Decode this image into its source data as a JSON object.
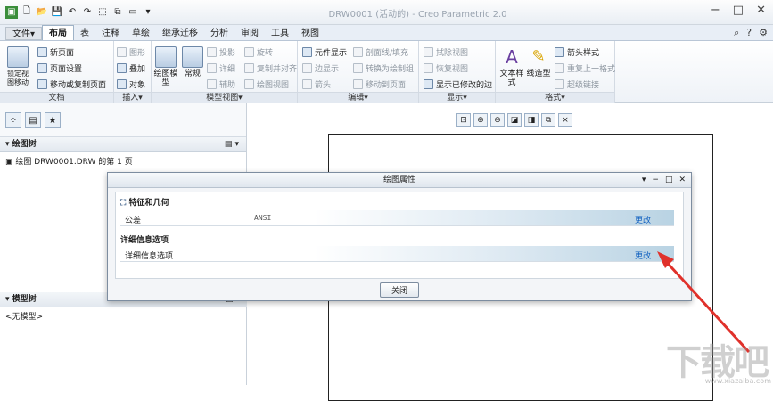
{
  "window": {
    "title": "DRW0001 (活动的) - Creo Parametric 2.0"
  },
  "tabs": [
    "文件▾",
    "布局",
    "表",
    "注释",
    "草绘",
    "继承迁移",
    "分析",
    "审阅",
    "工具",
    "视图"
  ],
  "ribbon": {
    "doc": {
      "label": "文档",
      "big": "锁定视图移动",
      "items": [
        "新页面",
        "页面设置",
        "移动或复制页面"
      ]
    },
    "insert": {
      "label": "插入▾",
      "items": [
        "图形",
        "叠加",
        "对象"
      ]
    },
    "model_views": {
      "label": "模型视图▾",
      "big1": "绘图模型",
      "big2": "常规",
      "items": [
        "投影",
        "详细",
        "辅助",
        "旋转",
        "复制并对齐",
        "绘图视图"
      ]
    },
    "edit": {
      "label": "编辑▾",
      "items": [
        "元件显示",
        "边显示",
        "箭头",
        "剖面线/填充",
        "转换为绘制组",
        "移动到页面"
      ]
    },
    "display": {
      "label": "显示▾",
      "items": [
        "拭除视图",
        "恢复视图",
        "显示已修改的边"
      ]
    },
    "format": {
      "label": "格式▾",
      "big1": "文本样式",
      "big2": "线造型",
      "items": [
        "箭头样式",
        "重复上一格式",
        "超级链接"
      ]
    }
  },
  "left": {
    "tree_title": "绘图树",
    "tree_item": "绘图 DRW0001.DRW 的第 1 页",
    "model_title": "模型树",
    "model_item": "<无模型>"
  },
  "dialog": {
    "title": "绘图属性",
    "section1": "特征和几何",
    "row1_key": "公差",
    "row1_val": "ANSI",
    "row1_link": "更改",
    "section2": "详细信息选项",
    "row2_key": "详细信息选项",
    "row2_link": "更改",
    "close": "关闭"
  },
  "watermark": "下载吧",
  "watermark_url": "www.xiazaiba.com"
}
